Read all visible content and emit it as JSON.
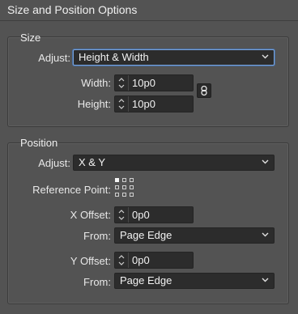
{
  "dialog": {
    "title": "Size and Position Options"
  },
  "size": {
    "title": "Size",
    "adjust_label": "Adjust:",
    "adjust_value": "Height & Width",
    "width_label": "Width:",
    "width_value": "10p0",
    "height_label": "Height:",
    "height_value": "10p0",
    "constrain_icon": "chain-link-icon"
  },
  "position": {
    "title": "Position",
    "adjust_label": "Adjust:",
    "adjust_value": "X & Y",
    "reference_label": "Reference Point:",
    "reference_selected": "top-left",
    "x_offset_label": "X Offset:",
    "x_offset_value": "0p0",
    "x_from_label": "From:",
    "x_from_value": "Page Edge",
    "y_offset_label": "Y Offset:",
    "y_offset_value": "0p0",
    "y_from_label": "From:",
    "y_from_value": "Page Edge"
  },
  "colors": {
    "panel": "#535353",
    "field": "#2c2c2c",
    "focus": "#7aa3d9"
  }
}
